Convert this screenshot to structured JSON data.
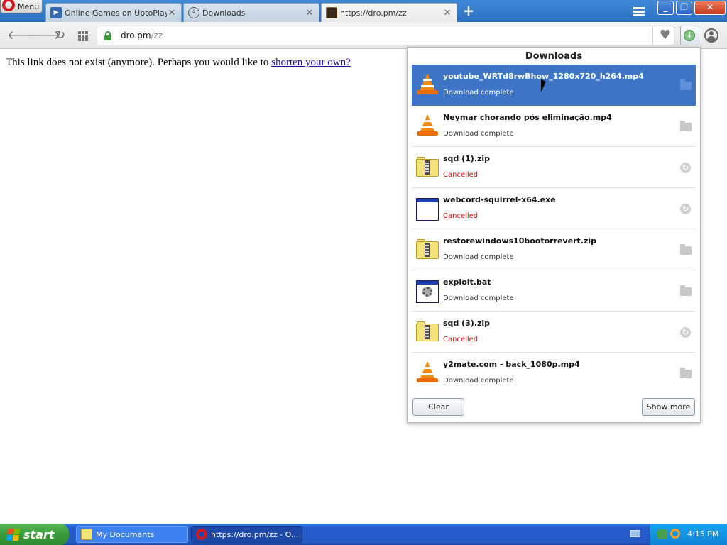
{
  "browser": {
    "menu_label": "Menu",
    "tabs": [
      {
        "title": "Online Games on UptoPlay — ",
        "favicon": "uptoplay-icon",
        "active": false
      },
      {
        "title": "Downloads",
        "favicon": "download-icon",
        "active": false
      },
      {
        "title": "https://dro.pm/zz",
        "favicon": "site-icon",
        "active": true
      }
    ],
    "new_tab_label": "+",
    "url_host": "dro.pm",
    "url_path": "/zz"
  },
  "page": {
    "message": "This link does not exist (anymore). Perhaps you would like to ",
    "link_text": "shorten your own?"
  },
  "downloads": {
    "title": "Downloads",
    "items": [
      {
        "name": "youtube_WRTd8rwBhow_1280x720_h264.mp4",
        "status": "Download complete",
        "icon": "vlc-icon",
        "action": "folder-icon",
        "selected": true
      },
      {
        "name": "Neymar chorando pós eliminação.mp4",
        "status": "Download complete",
        "icon": "vlc-icon",
        "action": "folder-icon"
      },
      {
        "name": "sqd (1).zip",
        "status": "Cancelled",
        "icon": "zip-icon",
        "action": "retry-icon"
      },
      {
        "name": "webcord-squirrel-x64.exe",
        "status": "Cancelled",
        "icon": "exe-icon",
        "action": "retry-icon"
      },
      {
        "name": "restorewindows10bootorrevert.zip",
        "status": "Download complete",
        "icon": "zip-icon",
        "action": "folder-icon"
      },
      {
        "name": "exploit.bat",
        "status": "Download complete",
        "icon": "bat-icon",
        "action": "folder-icon"
      },
      {
        "name": "sqd (3).zip",
        "status": "Cancelled",
        "icon": "zip-icon",
        "action": "retry-icon"
      },
      {
        "name": "y2mate.com - back_1080p.mp4",
        "status": "Download complete",
        "icon": "vlc-icon",
        "action": "folder-icon"
      }
    ],
    "clear_label": "Clear",
    "show_more_label": "Show more"
  },
  "taskbar": {
    "start_label": "start",
    "tasks": [
      {
        "label": "My Documents"
      },
      {
        "label": "https://dro.pm/zz - O..."
      }
    ],
    "clock": "4:15 PM"
  },
  "colors": {
    "selection": "#3d74c5",
    "cancelled": "#cc1111",
    "taskbar": "#245ac7",
    "start": "#3a9a3a"
  }
}
